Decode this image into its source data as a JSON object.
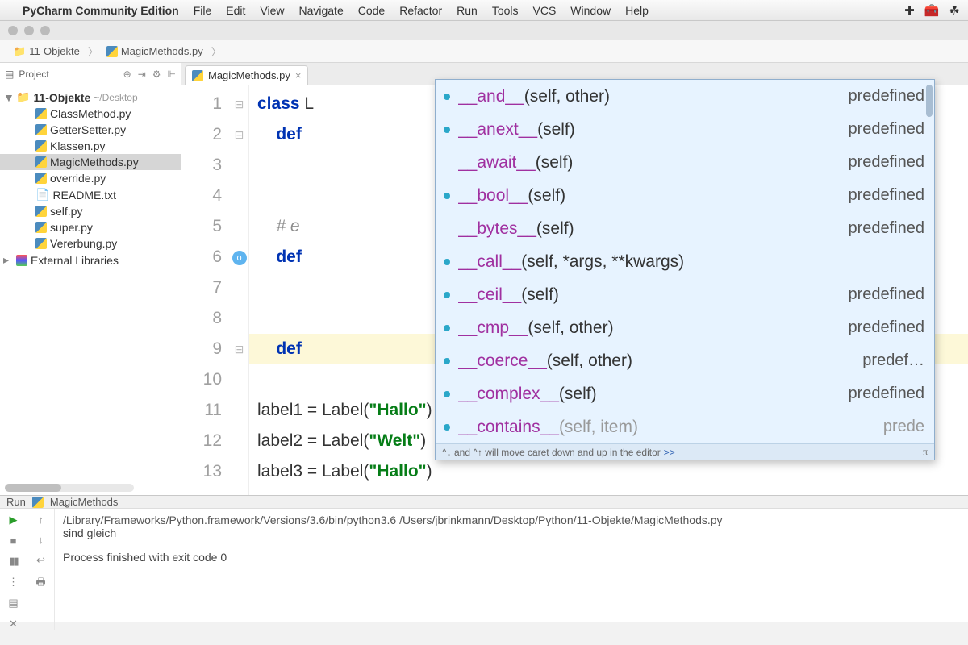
{
  "menubar": {
    "app_name": "PyCharm Community Edition",
    "items": [
      "File",
      "Edit",
      "View",
      "Navigate",
      "Code",
      "Refactor",
      "Run",
      "Tools",
      "VCS",
      "Window",
      "Help"
    ]
  },
  "breadcrumb": {
    "folder": "11-Objekte",
    "file": "MagicMethods.py"
  },
  "project": {
    "label": "Project",
    "root": "11-Objekte",
    "root_path": "~/Desktop",
    "files": [
      {
        "name": "ClassMethod.py"
      },
      {
        "name": "GetterSetter.py"
      },
      {
        "name": "Klassen.py"
      },
      {
        "name": "MagicMethods.py",
        "selected": true
      },
      {
        "name": "override.py"
      },
      {
        "name": "README.txt"
      },
      {
        "name": "self.py"
      },
      {
        "name": "super.py"
      },
      {
        "name": "Vererbung.py"
      }
    ],
    "external": "External Libraries"
  },
  "tab": {
    "name": "MagicMethods.py"
  },
  "code": {
    "lines": [
      {
        "n": "1",
        "html": "<span class='kw'>class</span> L"
      },
      {
        "n": "2",
        "html": "    <span class='kw'>def</span>"
      },
      {
        "n": "3",
        "html": ""
      },
      {
        "n": "4",
        "html": ""
      },
      {
        "n": "5",
        "html": "    <span class='com'># e</span>"
      },
      {
        "n": "6",
        "html": "    <span class='kw'>def</span>",
        "marker": true
      },
      {
        "n": "7",
        "html": ""
      },
      {
        "n": "8",
        "html": ""
      },
      {
        "n": "9",
        "html": "    <span class='kw'>def</span>",
        "current": true
      },
      {
        "n": "10",
        "html": ""
      },
      {
        "n": "11",
        "html": "label1 = Label(<span class='str'>\"Hallo\"</span>)"
      },
      {
        "n": "12",
        "html": "label2 = Label(<span class='str'>\"Welt\"</span>)"
      },
      {
        "n": "13",
        "html": "label3 = Label(<span class='str'>\"Hallo\"</span>)"
      }
    ]
  },
  "popup": {
    "items": [
      {
        "sig": "__and__(self, other)",
        "tag": "predefined",
        "bullet": true
      },
      {
        "sig": "__anext__(self)",
        "tag": "predefined",
        "bullet": true
      },
      {
        "sig": "__await__(self)",
        "tag": "predefined",
        "bullet": false
      },
      {
        "sig": "__bool__(self)",
        "tag": "predefined",
        "bullet": true
      },
      {
        "sig": "__bytes__(self)",
        "tag": "predefined",
        "bullet": false
      },
      {
        "sig": "__call__(self, *args, **kwargs)",
        "tag": "",
        "bullet": true
      },
      {
        "sig": "__ceil__(self)",
        "tag": "predefined",
        "bullet": true
      },
      {
        "sig": "__cmp__(self, other)",
        "tag": "predefined",
        "bullet": true
      },
      {
        "sig": "__coerce__(self, other)",
        "tag": "predef…",
        "bullet": true
      },
      {
        "sig": "__complex__(self)",
        "tag": "predefined",
        "bullet": true
      },
      {
        "sig": "__contains__(self, item)",
        "tag": "prede",
        "bullet": true,
        "last": true
      }
    ],
    "hint_prefix": "^↓ and ^↑ will move caret down and up in the editor",
    "hint_link": ">>"
  },
  "run": {
    "label": "Run",
    "config": "MagicMethods",
    "cmd": "/Library/Frameworks/Python.framework/Versions/3.6/bin/python3.6 /Users/jbrinkmann/Desktop/Python/11-Objekte/MagicMethods.py",
    "out1": "sind gleich",
    "out2": "Process finished with exit code 0"
  }
}
